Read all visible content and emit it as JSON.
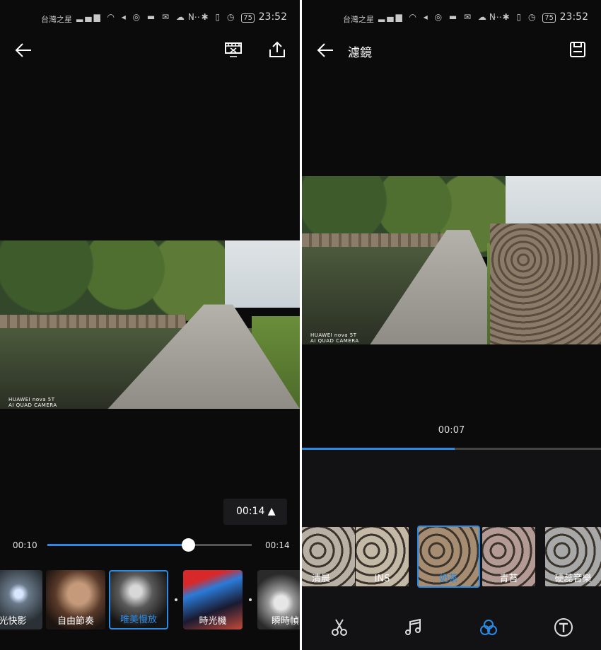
{
  "status": {
    "carrier": "台灣之星",
    "battery": "75",
    "time": "23:52"
  },
  "left": {
    "watermark": {
      "brand": "HUAWEI nova 5T",
      "camera": "AI QUAD CAMERA"
    },
    "duration_pill": "00:14 ▲",
    "scrub": {
      "start": "00:10",
      "end": "00:14",
      "progress": 0.69
    },
    "themes": [
      {
        "label": "時光快影",
        "visible_label": "光快影",
        "selected": false
      },
      {
        "label": "自由節奏",
        "selected": false
      },
      {
        "label": "唯美慢放",
        "selected": true
      },
      {
        "label": "時光機",
        "selected": false
      },
      {
        "label": "瞬時幀",
        "visible_label": "瞬時幀",
        "selected": false
      }
    ]
  },
  "right": {
    "title": "濾鏡",
    "watermark": {
      "brand": "HUAWEI nova 5T",
      "camera": "AI QUAD CAMERA"
    },
    "playback_time": "00:07",
    "progress": 0.51,
    "filters": [
      {
        "label": "清晨",
        "selected": false,
        "tint": "#b8b0a4"
      },
      {
        "label": "INS",
        "selected": false,
        "tint": "#c4b8a6"
      },
      {
        "label": "奶茶",
        "selected": true,
        "tint": "#a68d72"
      },
      {
        "label": "青苔",
        "selected": false,
        "tint": "#b49a94"
      },
      {
        "label": "硬蕊音樂",
        "selected": false,
        "tint": "#a8a8a8"
      }
    ],
    "tabs": [
      "scissors-icon",
      "music-icon",
      "filter-icon",
      "text-icon"
    ],
    "accent": "#2a8be6"
  }
}
